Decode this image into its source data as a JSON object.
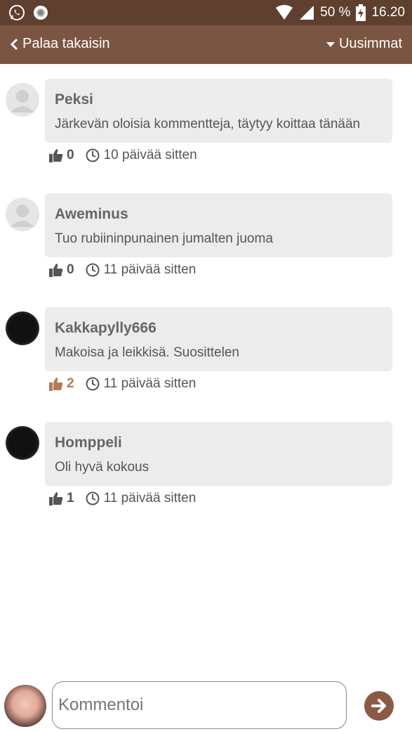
{
  "status_bar": {
    "battery": "50 %",
    "time": "16.20"
  },
  "nav": {
    "back_label": "Palaa takaisin",
    "sort_label": "Uusimmat"
  },
  "comments": [
    {
      "author": "Peksi",
      "text": "Järkevän oloisia kommentteja, täytyy koittaa tänään",
      "likes": "0",
      "time": "10 päivää sitten",
      "avatar": "default",
      "liked": false
    },
    {
      "author": "Aweminus",
      "text": "Tuo rubiininpunainen jumalten juoma",
      "likes": "0",
      "time": "11 päivää sitten",
      "avatar": "default",
      "liked": false
    },
    {
      "author": "Kakkapylly666",
      "text": "Makoisa ja leikkisä. Suosittelen",
      "likes": "2",
      "time": "11 päivää sitten",
      "avatar": "photo",
      "liked": true
    },
    {
      "author": "Homppeli",
      "text": "Oli hyvä kokous",
      "likes": "1",
      "time": "11 päivää sitten",
      "avatar": "photo",
      "liked": false
    }
  ],
  "composer": {
    "placeholder": "Kommentoi"
  },
  "colors": {
    "status_bar": "#5f3f2e",
    "nav_bar": "#7a5542",
    "accent": "#8a5a44",
    "liked": "#b37a5a",
    "bubble": "#ececec"
  }
}
